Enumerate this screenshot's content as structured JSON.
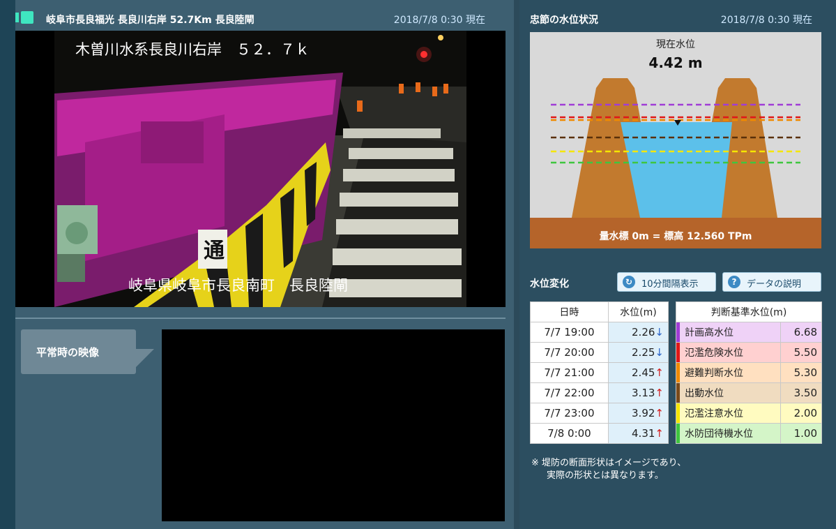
{
  "camera": {
    "title": "岐阜市長良福光 長良川右岸 52.7Km 長良陸閘",
    "timestamp": "2018/7/8 0:30 現在",
    "overlay_top": "木曽川水系長良川右岸　５２．７ｋ",
    "overlay_bottom": "岐阜県岐阜市長良南町　長良陸閘",
    "sign_char": "通"
  },
  "normal": {
    "label": "平常時の映像"
  },
  "status": {
    "title": "忠節の水位状況",
    "timestamp": "2018/7/8 0:30 現在",
    "current_label": "現在水位",
    "current_value": "4.42 m",
    "baseline_text": "量水標 0m = 標高 12.560 TPm"
  },
  "change": {
    "title": "水位変化",
    "interval_button": "10分間隔表示",
    "help_button": "データの説明",
    "col_time": "日時",
    "col_level": "水位(m)",
    "rows": [
      {
        "time": "7/7 19:00",
        "level": "2.26",
        "arrow": "↓"
      },
      {
        "time": "7/7 20:00",
        "level": "2.25",
        "arrow": "↓"
      },
      {
        "time": "7/7 21:00",
        "level": "2.45",
        "arrow": "↑"
      },
      {
        "time": "7/7 22:00",
        "level": "3.13",
        "arrow": "↑"
      },
      {
        "time": "7/7 23:00",
        "level": "3.92",
        "arrow": "↑"
      },
      {
        "time": "7/8 0:00",
        "level": "4.31",
        "arrow": "↑"
      }
    ]
  },
  "criteria": {
    "title": "判断基準水位(m)",
    "rows": [
      {
        "name": "計画高水位",
        "value": "6.68",
        "color": "#a03cd6",
        "bg": "#efd2f7"
      },
      {
        "name": "氾濫危険水位",
        "value": "5.50",
        "color": "#e01818",
        "bg": "#ffd0d0"
      },
      {
        "name": "避難判断水位",
        "value": "5.30",
        "color": "#f08a00",
        "bg": "#ffe0c0"
      },
      {
        "name": "出動水位",
        "value": "3.50",
        "color": "#7a4a1a",
        "bg": "#f0dcc0"
      },
      {
        "name": "氾濫注意水位",
        "value": "2.00",
        "color": "#f5e600",
        "bg": "#fffbc0"
      },
      {
        "name": "水防団待機水位",
        "value": "1.00",
        "color": "#3fc63f",
        "bg": "#d4f5c8"
      }
    ]
  },
  "note": {
    "line1": "※ 堤防の断面形状はイメージであり、",
    "line2": "実際の形状とは異なります。"
  }
}
